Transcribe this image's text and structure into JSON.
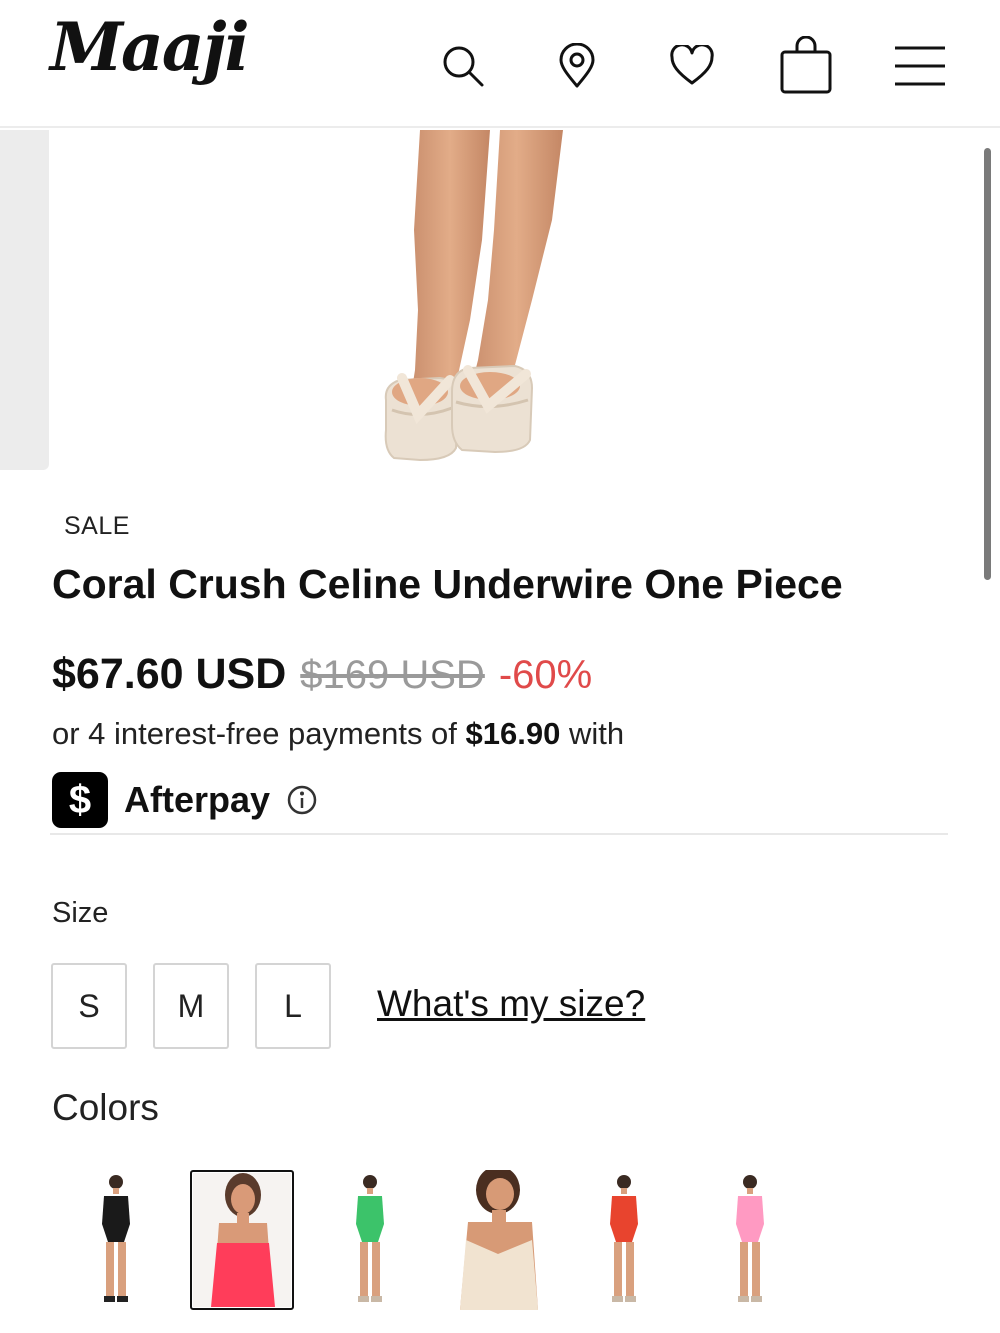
{
  "header": {
    "logo": "Maaji",
    "icons": [
      "search-icon",
      "location-pin-icon",
      "heart-icon",
      "shopping-bag-icon",
      "menu-icon"
    ]
  },
  "product": {
    "badge": "SALE",
    "title": "Coral Crush Celine Underwire One Piece",
    "price": "$67.60 USD",
    "original_price": "$169 USD",
    "discount": "-60%",
    "installment_prefix": "or 4 interest-free payments of",
    "installment_amount": "$16.90",
    "installment_suffix": "with",
    "afterpay_logo": "$",
    "afterpay_name": "Afterpay"
  },
  "size": {
    "label": "Size",
    "options": [
      "S",
      "M",
      "L"
    ],
    "guide_link": "What's my size?"
  },
  "colors": {
    "label": "Colors",
    "swatches": [
      {
        "color": "#1a1a1a",
        "selected": false
      },
      {
        "color": "#ff3d5a",
        "selected": true
      },
      {
        "color": "#3cc36a",
        "selected": false
      },
      {
        "color": "#f1e3d0",
        "selected": false
      },
      {
        "color": "#e8442e",
        "selected": false
      },
      {
        "color": "#ff9ac2",
        "selected": false
      }
    ]
  }
}
